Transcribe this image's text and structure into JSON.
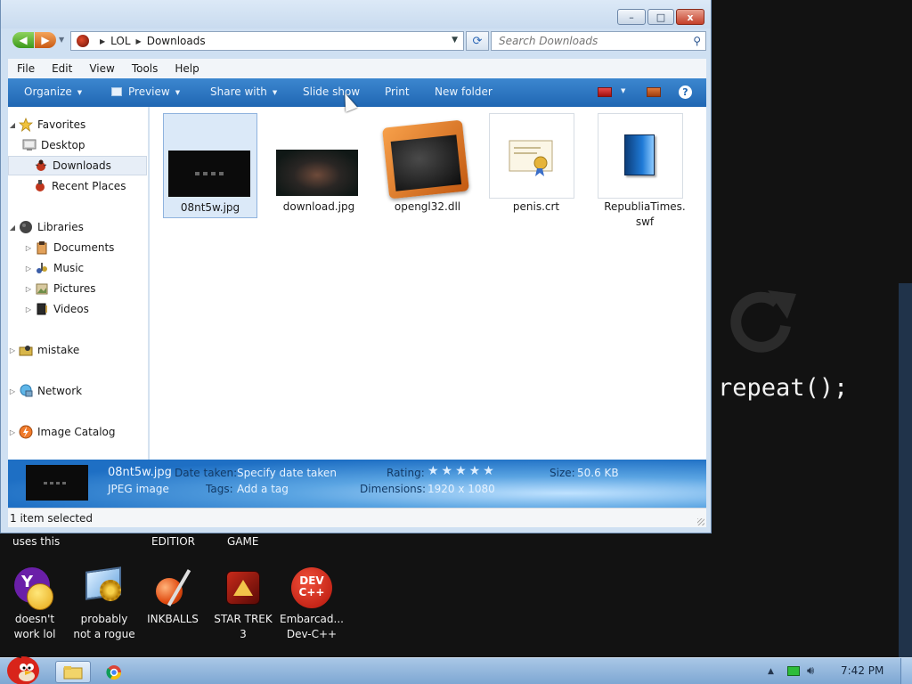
{
  "window": {
    "title_buttons": {
      "minimize": "–",
      "maximize": "□",
      "close": "x"
    }
  },
  "address": {
    "crumbs": [
      "LOL",
      "Downloads"
    ]
  },
  "search": {
    "placeholder": "Search Downloads"
  },
  "menu": [
    "File",
    "Edit",
    "View",
    "Tools",
    "Help"
  ],
  "toolbar": {
    "organize": "Organize",
    "preview": "Preview",
    "share_with": "Share with",
    "slide_show": "Slide show",
    "print": "Print",
    "new_folder": "New folder",
    "help": "?"
  },
  "nav_tree": {
    "favorites": "Favorites",
    "desktop": "Desktop",
    "downloads": "Downloads",
    "recent_places": "Recent Places",
    "libraries": "Libraries",
    "documents": "Documents",
    "music": "Music",
    "pictures": "Pictures",
    "videos": "Videos",
    "mistake": "mistake",
    "network": "Network",
    "image_catalog": "Image Catalog"
  },
  "files": [
    {
      "name": "08nt5w.jpg",
      "selected": true
    },
    {
      "name": "download.jpg",
      "selected": false
    },
    {
      "name": "opengl32.dll",
      "selected": false
    },
    {
      "name": "penis.crt",
      "selected": false
    },
    {
      "name_line1": "RepubliaTimes.",
      "name_line2": "swf",
      "selected": false
    }
  ],
  "details": {
    "file_name": "08nt5w.jpg",
    "file_type": "JPEG image",
    "date_taken_label": "Date taken:",
    "date_taken_value": "Specify date taken",
    "tags_label": "Tags:",
    "tags_value": "Add a tag",
    "rating_label": "Rating:",
    "rating_stars": "★★★★★",
    "dimensions_label": "Dimensions:",
    "dimensions_value": "1920 x 1080",
    "size_label": "Size:",
    "size_value": "50.6 KB"
  },
  "status": {
    "text": "1 item selected"
  },
  "desktop": {
    "repeat_text": "repeat();",
    "labels": {
      "uses_this": "uses this",
      "editior": "EDITIOR",
      "game": "GAME"
    },
    "icons": [
      {
        "line1": "doesn't",
        "line2": "work lol",
        "icon": "yahoo-messenger-icon"
      },
      {
        "line1": "probably",
        "line2": "not a rogue",
        "icon": "gear-monitor-icon"
      },
      {
        "line1": "INKBALLS",
        "line2": "",
        "icon": "inkball-icon"
      },
      {
        "line1": "STAR TREK",
        "line2": "3",
        "icon": "star-trek-icon"
      },
      {
        "line1": "Embarcad...",
        "line2": "Dev-C++",
        "icon": "dev-cpp-icon",
        "badge_line1": "DEV",
        "badge_line2": "C++"
      }
    ]
  },
  "taskbar": {
    "clock": "7:42 PM"
  },
  "colors": {
    "toolbar_blue": "#2067b3",
    "desktop_bg": "#121212",
    "selection": "#dbe9f8"
  }
}
